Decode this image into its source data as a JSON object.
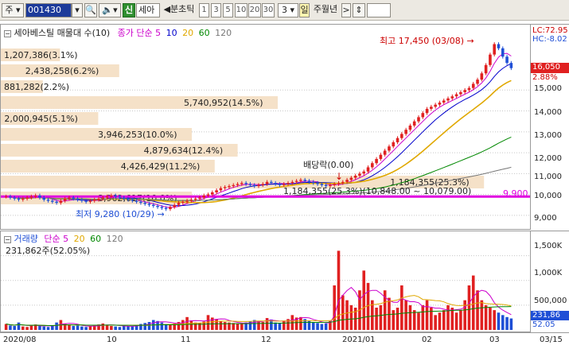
{
  "toolbar": {
    "market": "주",
    "code": "001430",
    "stock_name": "세아",
    "new_label": "신",
    "period_label": "분초틱",
    "intervals": [
      "1",
      "3",
      "5",
      "10",
      "20",
      "30"
    ],
    "interval_count": "3",
    "day_label": "일",
    "week_month_year": "주월년"
  },
  "price_panel": {
    "title": "세아베스틸 매물대 수(10)",
    "ma_title": "종가 단순 5",
    "ma_periods": [
      "10",
      "20",
      "60",
      "120"
    ],
    "ma_colors": [
      "#cc00cc",
      "#0000cc",
      "#e0a800",
      "#008800",
      "#777777"
    ],
    "lc_label": "LC:72.95",
    "hc_label": "HC:-8.02",
    "current_price": "16,050",
    "current_change": "2.88%",
    "high_annotation": "최고 17,450 (03/08)",
    "low_annotation": "최저 9,280 (10/29)",
    "ex_dividend_label": "배당락(0.00)",
    "ex_dividend_detail": "1,184,355(25.3%)(10,848.00 ~ 10,079.00)",
    "reference_line_label": "9,900",
    "reference_line_color": "#e000e0",
    "volume_profile": [
      {
        "label": "1,207,386(3.1%)",
        "fraction": 0.031
      },
      {
        "label": "2,438,258(6.2%)",
        "fraction": 0.062
      },
      {
        "label": "881,282(2.2%)",
        "fraction": 0.022
      },
      {
        "label": "5,740,952(14.5%)",
        "fraction": 0.145
      },
      {
        "label": "2,000,945(5.1%)",
        "fraction": 0.051
      },
      {
        "label": "3,946,253(10.0%)",
        "fraction": 0.1
      },
      {
        "label": "4,879,634(12.4%)",
        "fraction": 0.124
      },
      {
        "label": "4,426,429(11.2%)",
        "fraction": 0.112
      },
      {
        "label": "1,184,355(25.3%)",
        "fraction": 0.253
      },
      {
        "label": "3,962,617(10.0%)",
        "fraction": 0.1
      }
    ]
  },
  "price_axis": {
    "ticks": [
      "15,000",
      "14,000",
      "13,000",
      "12,000",
      "11,000",
      "10,000",
      "9,000"
    ]
  },
  "volume_panel": {
    "title": "거래량",
    "ma_title": "단순 5",
    "ma_periods": [
      "20",
      "60",
      "120"
    ],
    "current_volume": "231,862주(52.05%)",
    "axis_badge_volume": "231,86",
    "axis_badge_pct": "52.05"
  },
  "volume_axis": {
    "ticks": [
      "1,500K",
      "1,000K",
      "500,000"
    ]
  },
  "date_axis": {
    "labels": [
      "2020/08",
      "10",
      "11",
      "12",
      "2021/01",
      "02",
      "03",
      "03/15"
    ]
  },
  "colors": {
    "up": "#e02020",
    "down": "#1f4fd6",
    "profile_fill": "#f5e1c8",
    "grid": "#c8c8c8"
  },
  "chart_data": {
    "type": "candlestick",
    "price_range": [
      8500,
      17600
    ],
    "volume_range": [
      0,
      1800000
    ],
    "high": 17450,
    "low": 9280,
    "last": 16050,
    "closes": [
      9900,
      9850,
      9800,
      9750,
      9800,
      9850,
      9900,
      9950,
      9850,
      9750,
      9700,
      9650,
      9600,
      9700,
      9800,
      9850,
      9800,
      9750,
      9700,
      9650,
      9700,
      9750,
      9800,
      9850,
      9900,
      9950,
      9900,
      9850,
      9800,
      9750,
      9700,
      9650,
      9600,
      9550,
      9500,
      9450,
      9400,
      9350,
      9300,
      9400,
      9500,
      9600,
      9650,
      9700,
      9750,
      9800,
      9850,
      9950,
      10000,
      10100,
      10200,
      10300,
      10350,
      10400,
      10450,
      10500,
      10550,
      10500,
      10450,
      10400,
      10450,
      10500,
      10600,
      10550,
      10500,
      10450,
      10500,
      10550,
      10600,
      10650,
      10700,
      10650,
      10600,
      10550,
      10500,
      10450,
      10400,
      10450,
      10500,
      10550,
      10600,
      10700,
      10800,
      10900,
      11000,
      11100,
      11300,
      11500,
      11700,
      11900,
      12100,
      12300,
      12500,
      12700,
      12900,
      13100,
      13300,
      13500,
      13700,
      13900,
      14100,
      14200,
      14300,
      14400,
      14500,
      14600,
      14700,
      14800,
      14900,
      15000,
      15100,
      15300,
      15500,
      15800,
      16200,
      16700,
      17200,
      17000,
      16600,
      16300,
      16050
    ],
    "volumes": [
      120000,
      90000,
      80000,
      150000,
      70000,
      60000,
      90000,
      110000,
      80000,
      70000,
      60000,
      90000,
      150000,
      200000,
      120000,
      100000,
      80000,
      90000,
      70000,
      60000,
      80000,
      90000,
      110000,
      130000,
      100000,
      80000,
      70000,
      60000,
      90000,
      80000,
      70000,
      100000,
      120000,
      140000,
      160000,
      200000,
      180000,
      150000,
      120000,
      110000,
      130000,
      160000,
      200000,
      260000,
      180000,
      150000,
      140000,
      170000,
      300000,
      250000,
      220000,
      180000,
      160000,
      150000,
      140000,
      130000,
      120000,
      150000,
      170000,
      200000,
      180000,
      160000,
      240000,
      210000,
      150000,
      130000,
      180000,
      220000,
      300000,
      250000,
      260000,
      220000,
      180000,
      150000,
      140000,
      120000,
      130000,
      180000,
      900000,
      1600000,
      700000,
      600000,
      500000,
      450000,
      800000,
      1200000,
      950000,
      600000,
      450000,
      500000,
      800000,
      650000,
      400000,
      450000,
      900000,
      600000,
      500000,
      400000,
      350000,
      500000,
      600000,
      450000,
      300000,
      350000,
      400000,
      500000,
      450000,
      350000,
      400000,
      600000,
      900000,
      1100000,
      800000,
      600000,
      500000,
      450000,
      400000,
      350000,
      300000,
      260000,
      231862
    ]
  }
}
